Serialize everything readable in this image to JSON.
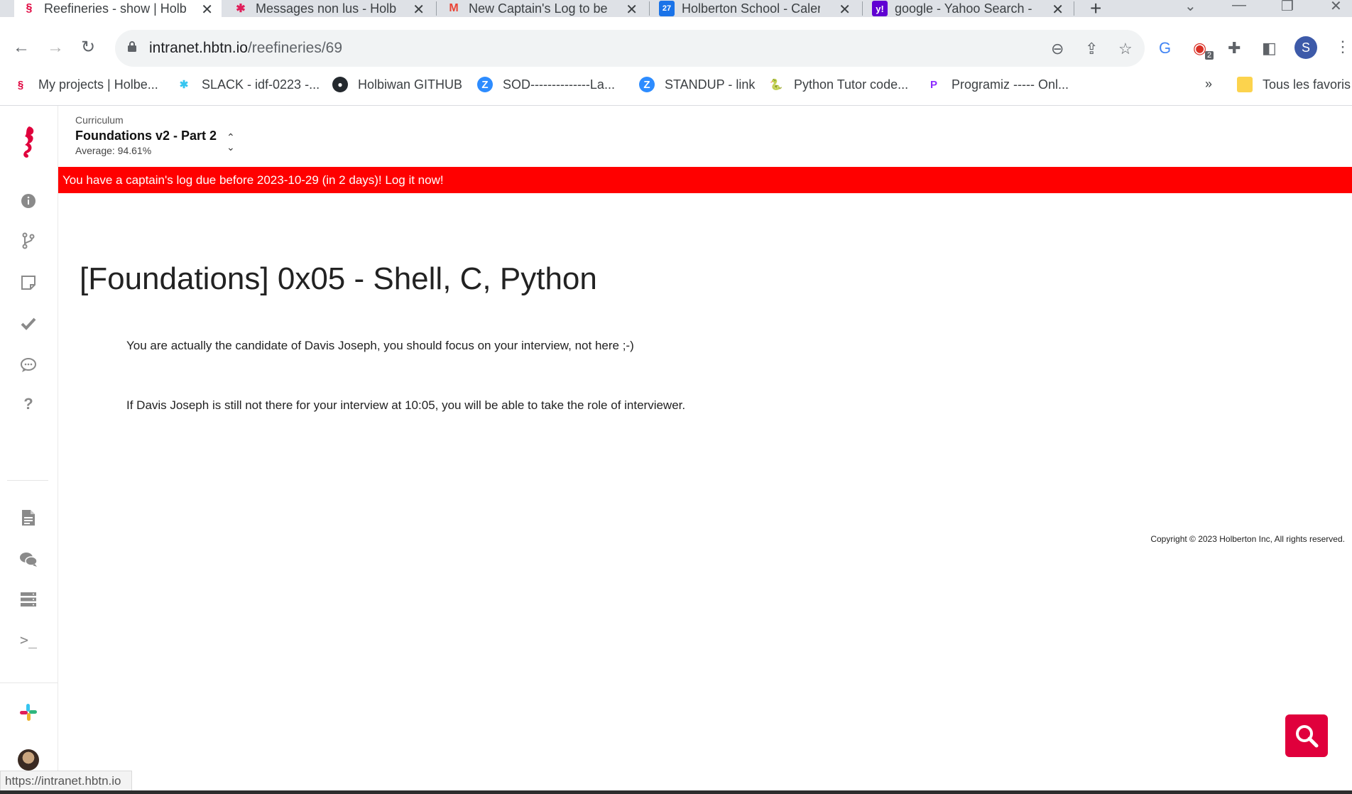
{
  "browser": {
    "tabs": [
      {
        "title": "Reefineries - show | Holb",
        "active": true
      },
      {
        "title": "Messages non lus - Holb",
        "active": false
      },
      {
        "title": "New Captain's Log to be",
        "active": false
      },
      {
        "title": "Holberton School - Caler",
        "active": false
      },
      {
        "title": "google - Yahoo Search -",
        "active": false
      }
    ],
    "calendar_badge": "27",
    "url_host": "intranet.hbtn.io",
    "url_path": "/reefineries/69",
    "extension_badge": "2",
    "profile_initial": "S",
    "bookmarks": [
      "My projects | Holbe...",
      "SLACK - idf-0223 -...",
      "Holbiwan GITHUB",
      "SOD--------------La...",
      "STANDUP - link",
      "Python Tutor code...",
      "Programiz ----- Onl..."
    ],
    "bookmarks_more": "»",
    "all_bookmarks": "Tous les favoris",
    "status_url": "https://intranet.hbtn.io"
  },
  "page": {
    "curriculum_label": "Curriculum",
    "curriculum_name": "Foundations v2 - Part 2",
    "average": "Average: 94.61%",
    "banner": "You have a captain's log due before 2023-10-29 (in 2 days)! Log it now!",
    "title": "[Foundations] 0x05 - Shell, C, Python",
    "paragraph1": "You are actually the candidate of Davis Joseph, you should focus on your interview, not here ;-)",
    "paragraph2": "If Davis Joseph is still not there for your interview at 10:05, you will be able to take the role of interviewer.",
    "copyright": "Copyright © 2023 Holberton Inc, All rights reserved."
  },
  "colors": {
    "banner": "#ff0000",
    "brand": "#e0003c"
  }
}
